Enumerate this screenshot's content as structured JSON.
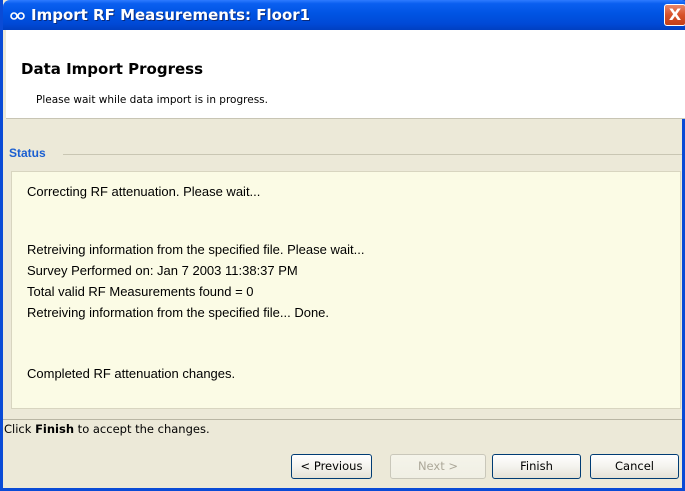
{
  "window": {
    "title": "Import RF Measurements: Floor1",
    "close_label": "X"
  },
  "header": {
    "title": "Data Import Progress",
    "subtitle": "Please wait while data import is in progress."
  },
  "status": {
    "label": "Status",
    "lines": [
      "Correcting RF attenuation. Please wait...",
      "Retreiving information from the specified file. Please wait...",
      "Survey Performed on: Jan 7 2003 11:38:37 PM",
      "Total valid RF Measurements found = 0",
      "Retreiving information from the specified file... Done.",
      "Completed RF attenuation changes."
    ]
  },
  "hint": {
    "prefix": "Click ",
    "emphasis": "Finish",
    "suffix": " to accept the changes."
  },
  "buttons": {
    "previous": "< Previous",
    "next": "Next >",
    "finish": "Finish",
    "cancel": "Cancel"
  },
  "colors": {
    "titlebar": "#0054e3",
    "status_label": "#1b5fd1",
    "status_bg": "#fbfbe5",
    "dialog_bg": "#ece9d8"
  },
  "icons": {
    "app": "rf-signal-icon",
    "close": "close-icon"
  }
}
